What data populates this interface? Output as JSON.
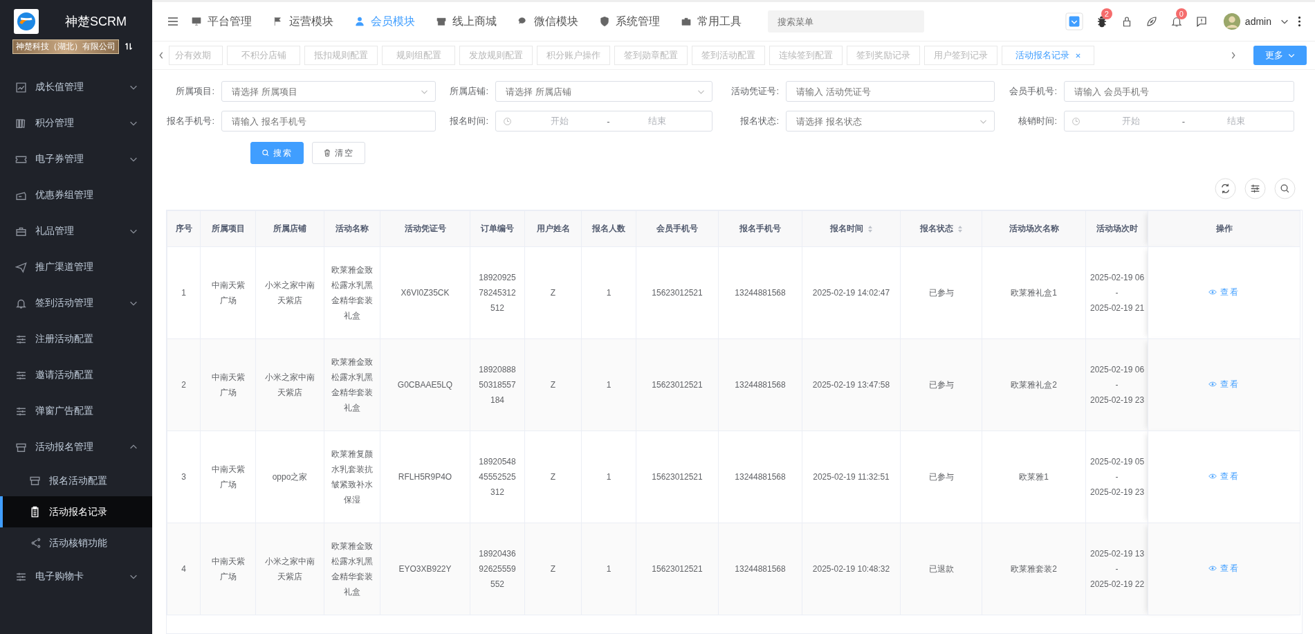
{
  "brand": {
    "title": "神楚SCRM",
    "company": "神楚科技（湖北）有限公司"
  },
  "sidebar": {
    "items": [
      {
        "label": "成长值管理",
        "kind": "group",
        "expanded": false,
        "selected": false
      },
      {
        "label": "积分管理",
        "kind": "group",
        "expanded": false,
        "selected": false
      },
      {
        "label": "电子券管理",
        "kind": "group",
        "expanded": false,
        "selected": false
      },
      {
        "label": "优惠券组管理",
        "kind": "link",
        "selected": false
      },
      {
        "label": "礼品管理",
        "kind": "group",
        "expanded": false,
        "selected": false
      },
      {
        "label": "推广渠道管理",
        "kind": "link",
        "selected": false
      },
      {
        "label": "签到活动管理",
        "kind": "group",
        "expanded": false,
        "selected": false
      },
      {
        "label": "注册活动配置",
        "kind": "link",
        "selected": false
      },
      {
        "label": "邀请活动配置",
        "kind": "link",
        "selected": false
      },
      {
        "label": "弹窗广告配置",
        "kind": "link",
        "selected": false
      },
      {
        "label": "活动报名管理",
        "kind": "group",
        "expanded": true,
        "selected": false,
        "children": [
          {
            "label": "报名活动配置",
            "selected": false
          },
          {
            "label": "活动报名记录",
            "selected": true
          },
          {
            "label": "活动核销功能",
            "selected": false
          }
        ]
      },
      {
        "label": "电子购物卡",
        "kind": "group",
        "expanded": false,
        "selected": false
      }
    ]
  },
  "nav": {
    "items": [
      {
        "label": "平台管理",
        "selected": false
      },
      {
        "label": "运营模块",
        "selected": false
      },
      {
        "label": "会员模块",
        "selected": true
      },
      {
        "label": "线上商城",
        "selected": false
      },
      {
        "label": "微信模块",
        "selected": false
      },
      {
        "label": "系统管理",
        "selected": false
      },
      {
        "label": "常用工具",
        "selected": false
      }
    ],
    "search": {
      "placeholder": "搜索菜单"
    },
    "badges": {
      "bug": "2",
      "bell": "0"
    },
    "user": "admin"
  },
  "tabs": {
    "items": [
      {
        "label": "分有效期",
        "selected": false
      },
      {
        "label": "不积分店铺",
        "selected": false
      },
      {
        "label": "抵扣规则配置",
        "selected": false
      },
      {
        "label": "规则组配置",
        "selected": false
      },
      {
        "label": "发放规则配置",
        "selected": false
      },
      {
        "label": "积分账户操作",
        "selected": false
      },
      {
        "label": "签到勋章配置",
        "selected": false
      },
      {
        "label": "签到活动配置",
        "selected": false
      },
      {
        "label": "连续签到配置",
        "selected": false
      },
      {
        "label": "签到奖励记录",
        "selected": false
      },
      {
        "label": "用户签到记录",
        "selected": false
      },
      {
        "label": "活动报名记录",
        "selected": true
      }
    ],
    "more": "更多"
  },
  "filters": [
    {
      "label": "所属项目:",
      "kind": "select",
      "placeholder": "请选择 所属项目"
    },
    {
      "label": "所属店铺:",
      "kind": "select",
      "placeholder": "请选择 所属店铺"
    },
    {
      "label": "活动凭证号:",
      "kind": "input",
      "placeholder": "请输入 活动凭证号"
    },
    {
      "label": "会员手机号:",
      "kind": "input",
      "placeholder": "请输入 会员手机号"
    },
    {
      "label": "报名手机号:",
      "kind": "input",
      "placeholder": "请输入 报名手机号"
    },
    {
      "label": "报名时间:",
      "kind": "daterange",
      "start": "开始",
      "separator": "-",
      "end": "结束"
    },
    {
      "label": "报名状态:",
      "kind": "select",
      "placeholder": "请选择 报名状态"
    },
    {
      "label": "核销时间:",
      "kind": "daterange",
      "start": "开始",
      "separator": "-",
      "end": "结束"
    }
  ],
  "actions": {
    "search": "搜索",
    "clear": "清空"
  },
  "table": {
    "columns": [
      {
        "label": "序号",
        "sortable": false
      },
      {
        "label": "所属项目",
        "sortable": false
      },
      {
        "label": "所属店铺",
        "sortable": false
      },
      {
        "label": "活动名称",
        "sortable": false
      },
      {
        "label": "活动凭证号",
        "sortable": false
      },
      {
        "label": "订单编号",
        "sortable": false
      },
      {
        "label": "用户姓名",
        "sortable": false
      },
      {
        "label": "报名人数",
        "sortable": false
      },
      {
        "label": "会员手机号",
        "sortable": false
      },
      {
        "label": "报名手机号",
        "sortable": false
      },
      {
        "label": "报名时间",
        "sortable": true
      },
      {
        "label": "报名状态",
        "sortable": true
      },
      {
        "label": "活动场次名称",
        "sortable": false
      },
      {
        "label": "活动场次时",
        "sortable": false
      },
      {
        "label": "操作",
        "sortable": false
      }
    ],
    "rows": [
      {
        "cells": [
          "1",
          "中南天紫广场",
          "小米之家中南天紫店",
          "欧莱雅金致松露水乳黑金精华套装礼盒",
          "X6VI0Z35CK",
          "1892092578245312512",
          "Z",
          "1",
          "15623012521",
          "13244881568",
          "2025-02-19 14:02:47",
          "已参与",
          "欧莱雅礼盒1",
          [
            "2025-02-19 06",
            "-",
            "2025-02-19 21"
          ]
        ],
        "action": "查看"
      },
      {
        "cells": [
          "2",
          "中南天紫广场",
          "小米之家中南天紫店",
          "欧莱雅金致松露水乳黑金精华套装礼盒",
          "G0CBAAE5LQ",
          "1892088850318557184",
          "Z",
          "1",
          "15623012521",
          "13244881568",
          "2025-02-19 13:47:58",
          "已参与",
          "欧莱雅礼盒2",
          [
            "2025-02-19 06",
            "-",
            "2025-02-19 23"
          ]
        ],
        "action": "查看"
      },
      {
        "cells": [
          "3",
          "中南天紫广场",
          "oppo之家",
          "欧莱雅复颜水乳套装抗皱紧致补水保湿",
          "RFLH5R9P4O",
          "1892054845552525312",
          "Z",
          "1",
          "15623012521",
          "13244881568",
          "2025-02-19 11:32:51",
          "已参与",
          "欧莱雅1",
          [
            "2025-02-19 05",
            "-",
            "2025-02-19 23"
          ]
        ],
        "action": "查看"
      },
      {
        "cells": [
          "4",
          "中南天紫广场",
          "小米之家中南天紫店",
          "欧莱雅金致松露水乳黑金精华套装礼盒",
          "EYO3XB922Y",
          "1892043692625559552",
          "Z",
          "1",
          "15623012521",
          "13244881568",
          "2025-02-19 10:48:32",
          "已退款",
          "欧莱雅套装2",
          [
            "2025-02-19 13",
            "-",
            "2025-02-19 22"
          ]
        ],
        "action": "查看"
      }
    ]
  }
}
